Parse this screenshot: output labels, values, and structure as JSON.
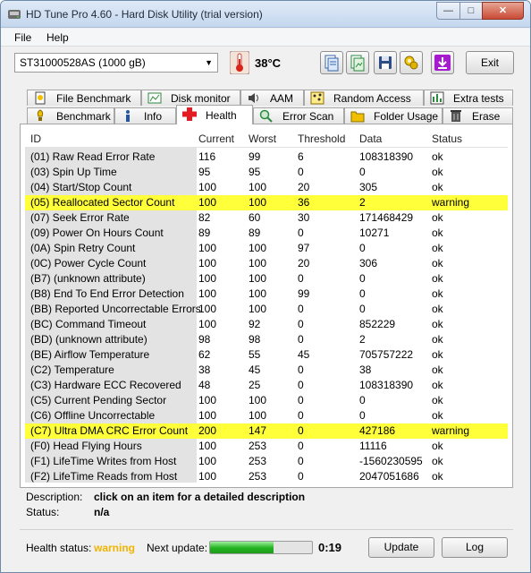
{
  "window": {
    "title": "HD Tune Pro 4.60 - Hard Disk Utility (trial version)",
    "minimize": "—",
    "maximize": "□",
    "close": "✕"
  },
  "menu": [
    "File",
    "Help"
  ],
  "toolbar": {
    "drive": "ST31000528AS (1000 gB)",
    "temperature": "38°C",
    "exit": "Exit",
    "icons": [
      "copy-info-icon",
      "copy-screenshot-icon",
      "save-icon",
      "options-icon",
      "download-icon"
    ]
  },
  "tabs": {
    "row1": [
      {
        "label": "File Benchmark",
        "icon": "file-benchmark-icon"
      },
      {
        "label": "Disk monitor",
        "icon": "disk-monitor-icon"
      },
      {
        "label": "AAM",
        "icon": "speaker-icon"
      },
      {
        "label": "Random Access",
        "icon": "random-access-icon"
      },
      {
        "label": "Extra tests",
        "icon": "extra-tests-icon"
      }
    ],
    "row2": [
      {
        "label": "Benchmark",
        "icon": "benchmark-icon"
      },
      {
        "label": "Info",
        "icon": "info-icon"
      },
      {
        "label": "Health",
        "icon": "health-cross-icon",
        "active": true
      },
      {
        "label": "Error Scan",
        "icon": "error-scan-icon"
      },
      {
        "label": "Folder Usage",
        "icon": "folder-icon"
      },
      {
        "label": "Erase",
        "icon": "trash-icon"
      }
    ]
  },
  "health_table": {
    "columns": [
      "ID",
      "Current",
      "Worst",
      "Threshold",
      "Data",
      "Status"
    ],
    "rows": [
      {
        "id": "(01) Raw Read Error Rate",
        "current": "116",
        "worst": "99",
        "threshold": "6",
        "data": "108318390",
        "status": "ok"
      },
      {
        "id": "(03) Spin Up Time",
        "current": "95",
        "worst": "95",
        "threshold": "0",
        "data": "0",
        "status": "ok"
      },
      {
        "id": "(04) Start/Stop Count",
        "current": "100",
        "worst": "100",
        "threshold": "20",
        "data": "305",
        "status": "ok"
      },
      {
        "id": "(05) Reallocated Sector Count",
        "current": "100",
        "worst": "100",
        "threshold": "36",
        "data": "2",
        "status": "warning"
      },
      {
        "id": "(07) Seek Error Rate",
        "current": "82",
        "worst": "60",
        "threshold": "30",
        "data": "171468429",
        "status": "ok"
      },
      {
        "id": "(09) Power On Hours Count",
        "current": "89",
        "worst": "89",
        "threshold": "0",
        "data": "10271",
        "status": "ok"
      },
      {
        "id": "(0A) Spin Retry Count",
        "current": "100",
        "worst": "100",
        "threshold": "97",
        "data": "0",
        "status": "ok"
      },
      {
        "id": "(0C) Power Cycle Count",
        "current": "100",
        "worst": "100",
        "threshold": "20",
        "data": "306",
        "status": "ok"
      },
      {
        "id": "(B7) (unknown attribute)",
        "current": "100",
        "worst": "100",
        "threshold": "0",
        "data": "0",
        "status": "ok"
      },
      {
        "id": "(B8) End To End Error Detection",
        "current": "100",
        "worst": "100",
        "threshold": "99",
        "data": "0",
        "status": "ok"
      },
      {
        "id": "(BB) Reported Uncorrectable Errors",
        "current": "100",
        "worst": "100",
        "threshold": "0",
        "data": "0",
        "status": "ok"
      },
      {
        "id": "(BC) Command Timeout",
        "current": "100",
        "worst": "92",
        "threshold": "0",
        "data": "852229",
        "status": "ok"
      },
      {
        "id": "(BD) (unknown attribute)",
        "current": "98",
        "worst": "98",
        "threshold": "0",
        "data": "2",
        "status": "ok"
      },
      {
        "id": "(BE) Airflow Temperature",
        "current": "62",
        "worst": "55",
        "threshold": "45",
        "data": "705757222",
        "status": "ok"
      },
      {
        "id": "(C2) Temperature",
        "current": "38",
        "worst": "45",
        "threshold": "0",
        "data": "38",
        "status": "ok"
      },
      {
        "id": "(C3) Hardware ECC Recovered",
        "current": "48",
        "worst": "25",
        "threshold": "0",
        "data": "108318390",
        "status": "ok"
      },
      {
        "id": "(C5) Current Pending Sector",
        "current": "100",
        "worst": "100",
        "threshold": "0",
        "data": "0",
        "status": "ok"
      },
      {
        "id": "(C6) Offline Uncorrectable",
        "current": "100",
        "worst": "100",
        "threshold": "0",
        "data": "0",
        "status": "ok"
      },
      {
        "id": "(C7) Ultra DMA CRC Error Count",
        "current": "200",
        "worst": "147",
        "threshold": "0",
        "data": "427186",
        "status": "warning"
      },
      {
        "id": "(F0) Head Flying Hours",
        "current": "100",
        "worst": "253",
        "threshold": "0",
        "data": "11116",
        "status": "ok"
      },
      {
        "id": "(F1) LifeTime Writes from Host",
        "current": "100",
        "worst": "253",
        "threshold": "0",
        "data": "-1560230595",
        "status": "ok"
      },
      {
        "id": "(F2) LifeTime Reads from Host",
        "current": "100",
        "worst": "253",
        "threshold": "0",
        "data": "2047051686",
        "status": "ok"
      }
    ]
  },
  "description": {
    "label": "Description:",
    "value": "click on an item for a detailed description",
    "status_label": "Status:",
    "status_value": "n/a"
  },
  "footer": {
    "health_status_label": "Health status:",
    "health_status_value": "warning",
    "next_update_label": "Next update:",
    "next_update_value": "0:19",
    "progress_fraction": 0.62,
    "update_button": "Update",
    "log_button": "Log"
  },
  "colors": {
    "warning_row": "#ffff3a",
    "warning_text": "#f0b400",
    "progress": "#22b21f"
  }
}
